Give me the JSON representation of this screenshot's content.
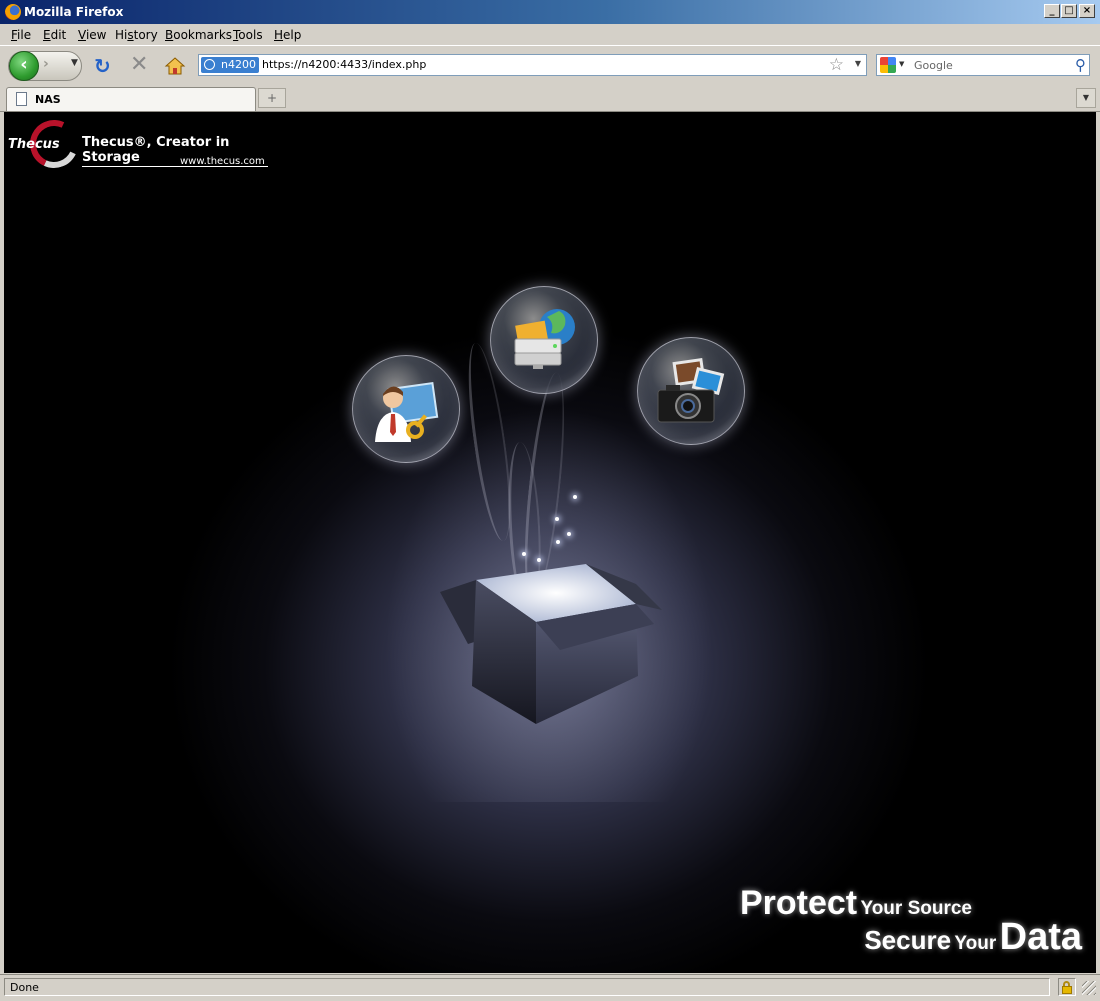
{
  "window": {
    "title": "Mozilla Firefox"
  },
  "menu": {
    "file": {
      "accel": "F",
      "rest": "ile"
    },
    "edit": {
      "accel": "E",
      "rest": "dit"
    },
    "view": {
      "accel": "V",
      "rest": "iew"
    },
    "history_pre": "Hi",
    "history_accel": "s",
    "history_post": "tory",
    "bookmarks": {
      "accel": "B",
      "rest": "ookmarks"
    },
    "tools": {
      "accel": "T",
      "rest": "ools"
    },
    "help": {
      "accel": "H",
      "rest": "elp"
    }
  },
  "navbar": {
    "site_identity": "n4200",
    "url": "https://n4200:4433/index.php",
    "search_placeholder": "Google"
  },
  "tabs": [
    {
      "label": "NAS"
    }
  ],
  "page": {
    "logo_brand": "Thecus",
    "logo_tagline": "Thecus®, Creator in Storage",
    "logo_url": "www.thecus.com",
    "slogan": {
      "protect": "Protect",
      "your_source": "Your Source",
      "secure": "Secure",
      "your": "Your",
      "data": "Data"
    },
    "bubbles": [
      "admin-key-icon",
      "web-disk-icon",
      "photo-camera-icon"
    ]
  },
  "status": {
    "text": "Done"
  },
  "colors": {
    "accent": "#b8122a",
    "titlebar": "#0a246a"
  }
}
